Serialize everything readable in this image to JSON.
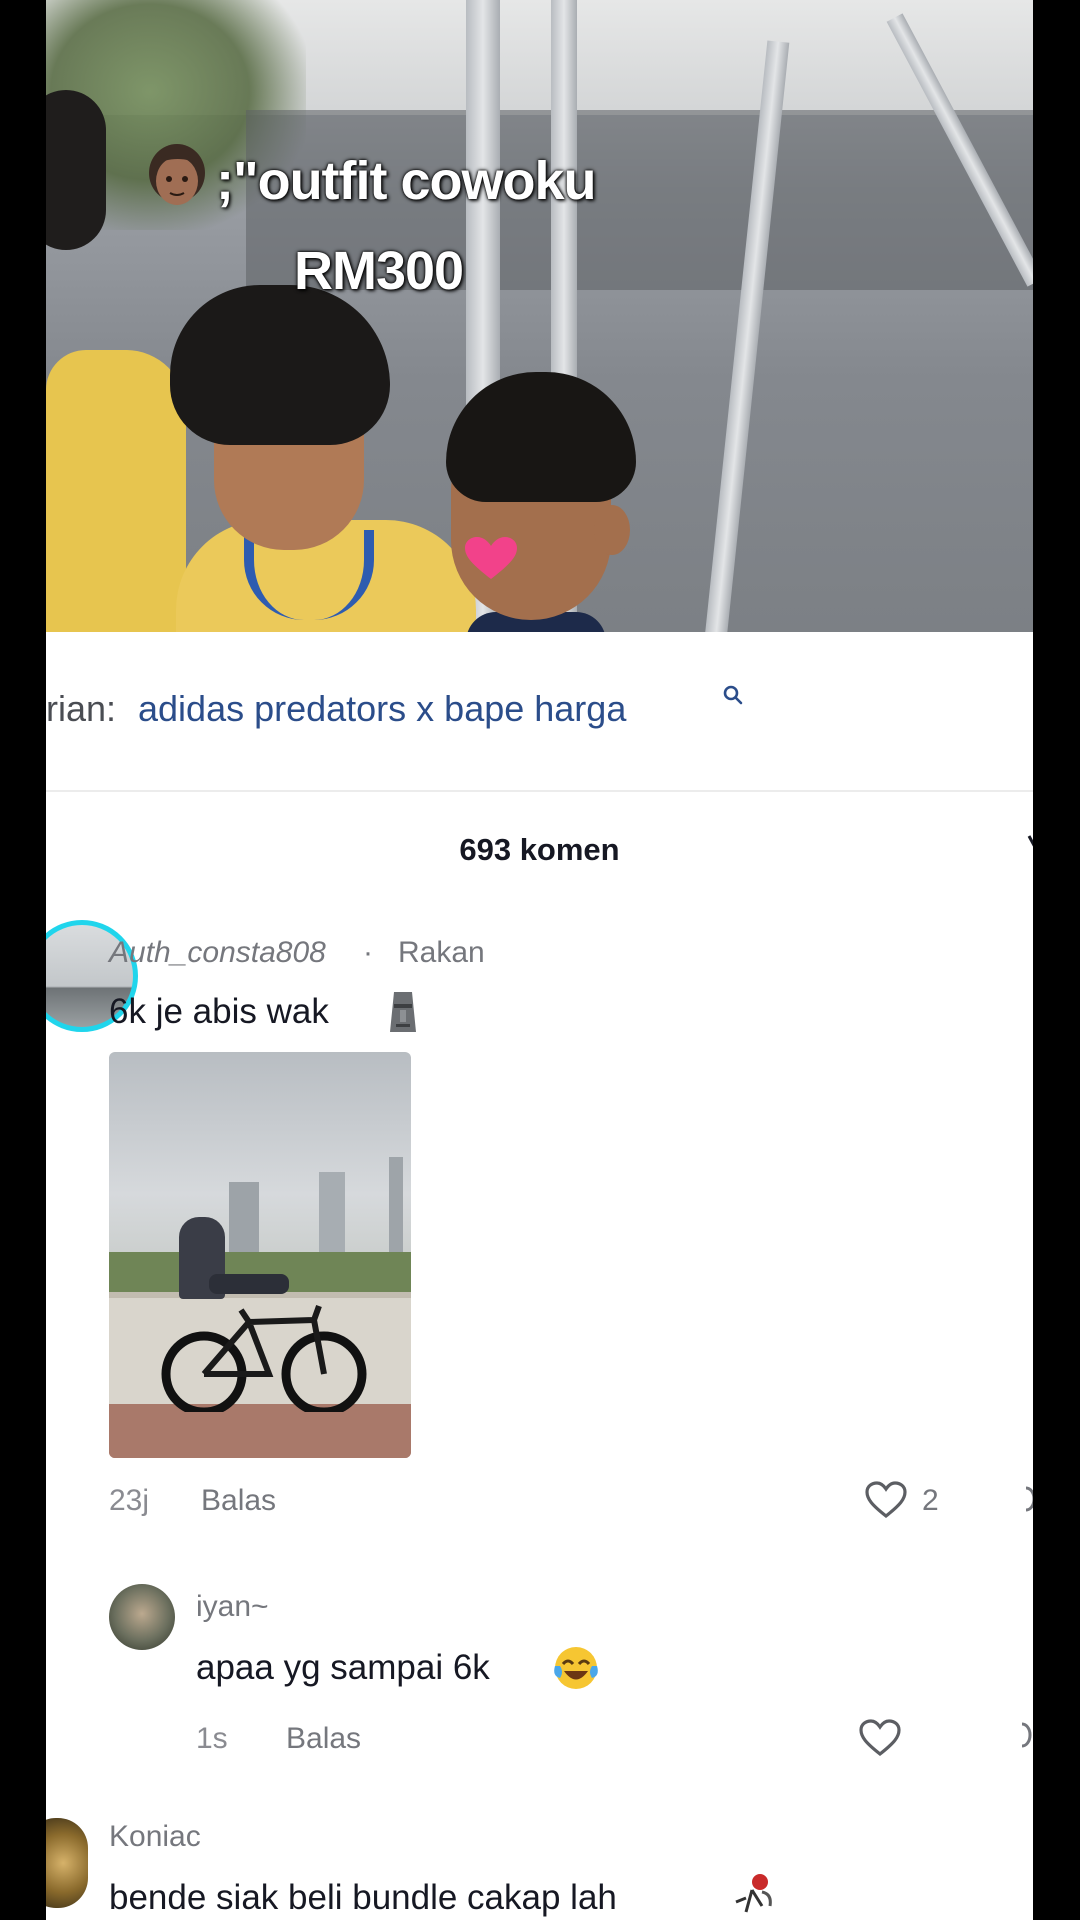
{
  "video": {
    "overlay_line1": ";\"outfit cowoku",
    "overlay_line2": "RM300"
  },
  "search": {
    "prefix": "rian:",
    "term": "adidas predators x bape harga"
  },
  "comments_header": {
    "count_label": "693 komen"
  },
  "comments": [
    {
      "username": "Auth_consta808",
      "separator": " · ",
      "relation": "Rakan",
      "text": "6k je abis wak",
      "emoji_icon": "moai-icon",
      "time": "23j",
      "reply_label": "Balas",
      "likes": "2"
    },
    {
      "username": "iyan~",
      "text": "apaa yg sampai 6k",
      "emoji_icon": "joy-emoji-icon",
      "time": "1s",
      "reply_label": "Balas",
      "likes": ""
    },
    {
      "username": "Koniac",
      "text": "bende siak beli bundle cakap lah",
      "emoji_icon": "figure-emoji-icon"
    }
  ],
  "colors": {
    "link_blue": "#2b4d8a",
    "avatar_ring": "#20d5ec",
    "text_primary": "#161823",
    "text_secondary": "#75777d"
  }
}
